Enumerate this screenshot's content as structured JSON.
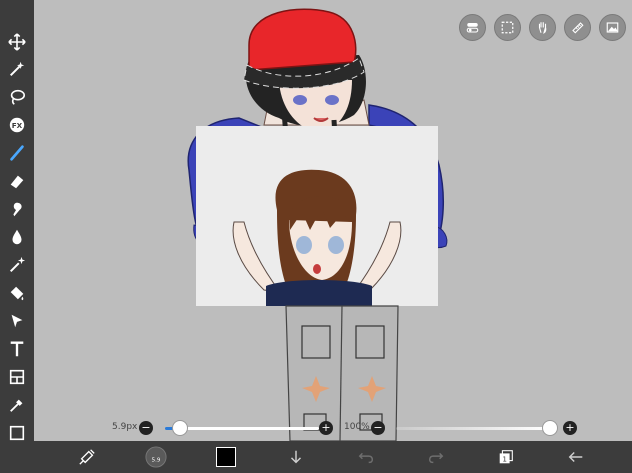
{
  "tools": [
    {
      "name": "move-icon",
      "glyph": "✥"
    },
    {
      "name": "magic-wand-icon",
      "glyph": "✧"
    },
    {
      "name": "lasso-icon",
      "glyph": "◯"
    },
    {
      "name": "fx-icon",
      "glyph": "FX"
    },
    {
      "name": "brush-icon",
      "glyph": "／",
      "active": true
    },
    {
      "name": "eraser-icon",
      "glyph": "▰"
    },
    {
      "name": "smudge-icon",
      "glyph": "●"
    },
    {
      "name": "blur-drop-icon",
      "glyph": "💧"
    },
    {
      "name": "magic-brush-icon",
      "glyph": "✦"
    },
    {
      "name": "fill-icon",
      "glyph": "◆"
    },
    {
      "name": "select-arrow-icon",
      "glyph": "➤"
    },
    {
      "name": "text-icon",
      "glyph": "T"
    },
    {
      "name": "frame-divider-icon",
      "glyph": "▦"
    },
    {
      "name": "eyedropper-icon",
      "glyph": "✎"
    },
    {
      "name": "canvas-icon",
      "glyph": "▢"
    }
  ],
  "top_buttons": [
    "toggle-icon",
    "selection-icon",
    "hand-icon",
    "ruler-icon",
    "image-icon"
  ],
  "brush": {
    "size_label": "5.9px",
    "size_fraction": 0.1,
    "opacity_label": "100%",
    "opacity_fraction": 1.0
  },
  "colors": {
    "active_tool": "#4aa8ff",
    "current_color": "#000000",
    "hat_red": "#e8262a",
    "sleeve_blue": "#3b43b8"
  },
  "bottom_buttons": [
    "transform-icon",
    "brush-preview-icon",
    "color-swatch",
    "download-icon",
    "undo-icon",
    "redo-icon",
    "layers-icon",
    "back-icon"
  ],
  "layers_count": "1"
}
